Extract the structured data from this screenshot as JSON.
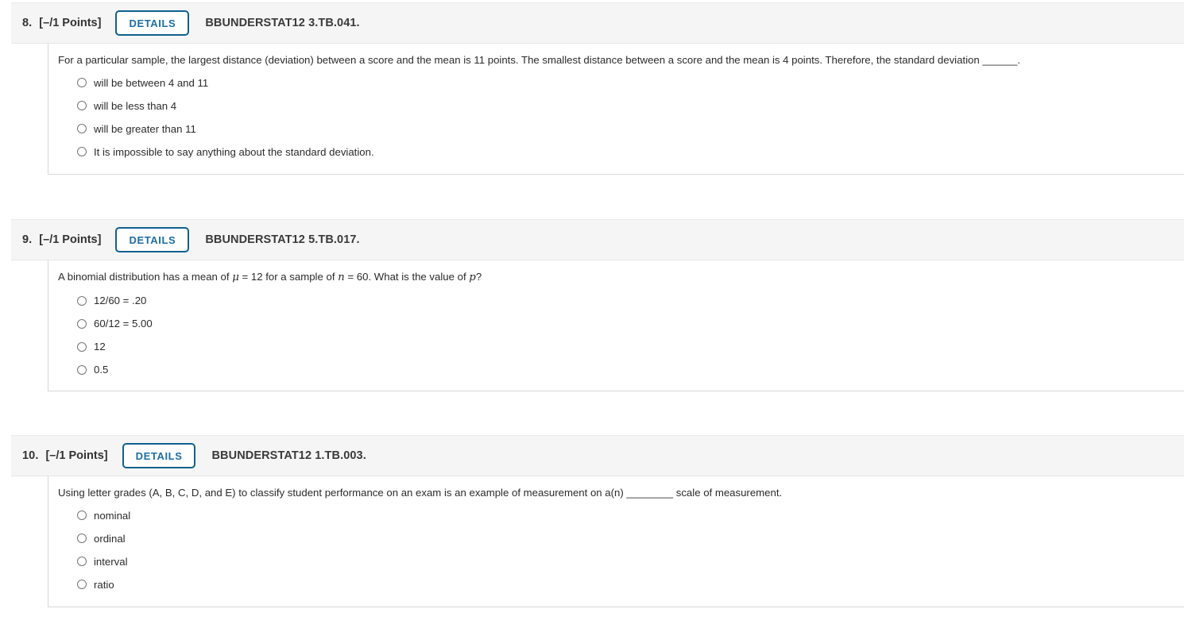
{
  "page": {
    "background_color": "#ffffff",
    "header_band_color": "#f5f5f5",
    "accent_color": "#10618f",
    "details_label_color": "#1b6ea5",
    "text_color": "#2b2b2b"
  },
  "questions": [
    {
      "number": "8.",
      "points": "[–/1 Points]",
      "details_label": "DETAILS",
      "code": "BBUNDERSTAT12 3.TB.041.",
      "prompt_parts": [
        {
          "type": "text",
          "text": "For a particular sample, the largest distance (deviation) between a score and the mean is 11 points. The smallest distance between a score and the mean is 4 points. Therefore, the standard deviation "
        },
        {
          "type": "blank",
          "text": "______"
        },
        {
          "type": "text",
          "text": "."
        }
      ],
      "prompt_plain": "For a particular sample, the largest distance (deviation) between a score and the mean is 11 points. The smallest distance between a score and the mean is 4 points. Therefore, the standard deviation ______.",
      "options": [
        {
          "label": "will be between 4 and 11",
          "selected": false
        },
        {
          "label": "will be less than 4",
          "selected": false
        },
        {
          "label": "will be greater than 11",
          "selected": false
        },
        {
          "label": "It is impossible to say anything about the standard deviation.",
          "selected": false
        }
      ]
    },
    {
      "number": "9.",
      "points": "[–/1 Points]",
      "details_label": "DETAILS",
      "code": "BBUNDERSTAT12 5.TB.017.",
      "prompt_parts": [
        {
          "type": "text",
          "text": "A binomial distribution has a mean of "
        },
        {
          "type": "math",
          "text": "μ"
        },
        {
          "type": "text",
          "text": " = 12 for a sample of "
        },
        {
          "type": "math",
          "text": "n"
        },
        {
          "type": "text",
          "text": " = 60. What is the value of "
        },
        {
          "type": "math",
          "text": "p"
        },
        {
          "type": "text",
          "text": "?"
        }
      ],
      "prompt_plain": "A binomial distribution has a mean of μ = 12 for a sample of n = 60. What is the value of p?",
      "options": [
        {
          "label": "12/60 = .20",
          "selected": false
        },
        {
          "label": "60/12 = 5.00",
          "selected": false
        },
        {
          "label": "12",
          "selected": false
        },
        {
          "label": "0.5",
          "selected": false
        }
      ]
    },
    {
      "number": "10.",
      "points": "[–/1 Points]",
      "details_label": "DETAILS",
      "code": "BBUNDERSTAT12 1.TB.003.",
      "prompt_parts": [
        {
          "type": "text",
          "text": "Using letter grades (A, B, C, D, and E) to classify student performance on an exam is an example of measurement on a(n) "
        },
        {
          "type": "blank",
          "text": "________"
        },
        {
          "type": "text",
          "text": " scale of measurement."
        }
      ],
      "prompt_plain": "Using letter grades (A, B, C, D, and E) to classify student performance on an exam is an example of measurement on a(n) ________ scale of measurement.",
      "options": [
        {
          "label": "nominal",
          "selected": false
        },
        {
          "label": "ordinal",
          "selected": false
        },
        {
          "label": "interval",
          "selected": false
        },
        {
          "label": "ratio",
          "selected": false
        }
      ]
    }
  ]
}
